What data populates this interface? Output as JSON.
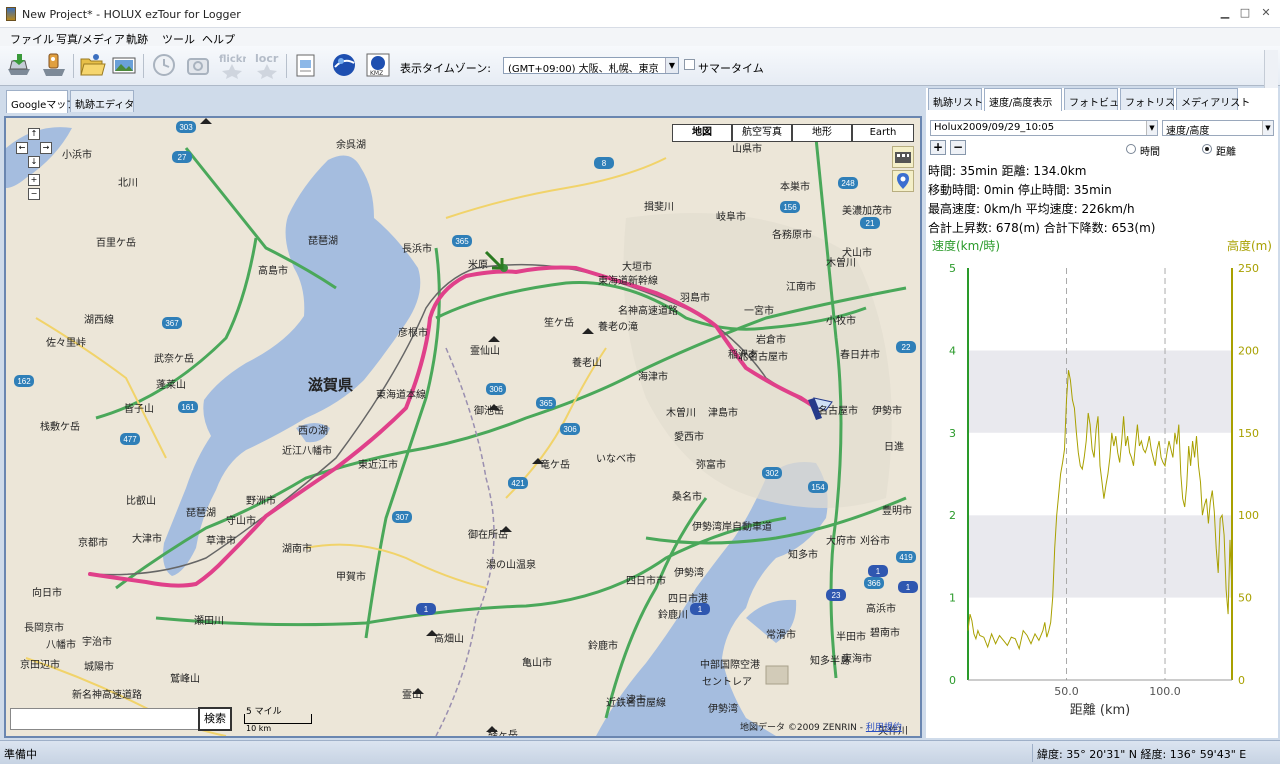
{
  "window": {
    "title": "New Project* - HOLUX ezTour for Logger"
  },
  "menu": [
    "ファイル",
    "写真/メディア",
    "軌跡",
    "ツール",
    "ヘルプ"
  ],
  "toolbar": {
    "timezone_label": "表示タイムゾーン:",
    "timezone_value": "(GMT+09:00) 大阪、札幌、東京",
    "dst_label": "サマータイム",
    "dst_checked": false,
    "icons": [
      "import-gps-icon",
      "gps-device-icon",
      "open-folder-icon",
      "photo-icon",
      "clock-icon",
      "camera-icon",
      "flickr-icon",
      "locr-icon",
      "export-file-icon",
      "google-earth-icon",
      "kmz-icon"
    ],
    "icon_texts": {
      "flickr": "flickr",
      "locr": "locr",
      "kmz": "KMZ"
    }
  },
  "left_tabs": [
    "Googleマップ",
    "軌跡エディタ"
  ],
  "map": {
    "types": [
      "地図",
      "航空写真",
      "地形",
      "Earth"
    ],
    "active_type": "地図",
    "nav": {
      "up": "↑",
      "left": "←",
      "right": "→",
      "down": "↓",
      "zoom_in": "+",
      "zoom_out": "−"
    },
    "search_button": "検索",
    "search_value": "",
    "scale_mi": "5 マイル",
    "scale_km": "10 km",
    "copyright": "地図データ ©2009 ZENRIN -",
    "terms_link": "利用規約",
    "labels": [
      {
        "t": "小浜市"
      },
      {
        "t": "余呉湖"
      },
      {
        "t": "北川"
      },
      {
        "t": "琵琶湖"
      },
      {
        "t": "長浜市"
      },
      {
        "t": "米原"
      },
      {
        "t": "東海道新幹線"
      },
      {
        "t": "名神高速道路"
      },
      {
        "t": "大垣市"
      },
      {
        "t": "羽島市"
      },
      {
        "t": "一宮市"
      },
      {
        "t": "岩倉市"
      },
      {
        "t": "北名古屋市"
      },
      {
        "t": "稲沢市"
      },
      {
        "t": "春日井市"
      },
      {
        "t": "名古屋市"
      },
      {
        "t": "滋賀県"
      },
      {
        "t": "東海道本線"
      },
      {
        "t": "彦根市"
      },
      {
        "t": "霊仙山"
      },
      {
        "t": "笙ケ岳"
      },
      {
        "t": "養老の滝"
      },
      {
        "t": "養老山"
      },
      {
        "t": "海津市"
      },
      {
        "t": "木曽川"
      },
      {
        "t": "津島市"
      },
      {
        "t": "愛西市"
      },
      {
        "t": "弥富市"
      },
      {
        "t": "桑名市"
      },
      {
        "t": "近江八幡市"
      },
      {
        "t": "西の湖"
      },
      {
        "t": "東近江市"
      },
      {
        "t": "御池岳"
      },
      {
        "t": "竜ケ岳"
      },
      {
        "t": "いなべ市"
      },
      {
        "t": "野洲市"
      },
      {
        "t": "守山市"
      },
      {
        "t": "草津市"
      },
      {
        "t": "湖南市"
      },
      {
        "t": "甲賀市"
      },
      {
        "t": "御在所岳"
      },
      {
        "t": "湯の山温泉"
      },
      {
        "t": "伊勢湾岸自動車道"
      },
      {
        "t": "四日市市"
      },
      {
        "t": "四日市港"
      },
      {
        "t": "鈴鹿川"
      },
      {
        "t": "伊勢湾"
      },
      {
        "t": "知多市"
      },
      {
        "t": "京都市"
      },
      {
        "t": "大津市"
      },
      {
        "t": "瀬田川"
      },
      {
        "t": "向日市"
      },
      {
        "t": "長岡京市"
      },
      {
        "t": "宇治市"
      },
      {
        "t": "城陽市"
      },
      {
        "t": "八幡市"
      },
      {
        "t": "京田辺市"
      },
      {
        "t": "新名神高速道路"
      },
      {
        "t": "高畑山"
      },
      {
        "t": "鈴鹿市"
      },
      {
        "t": "亀山市"
      },
      {
        "t": "津市"
      },
      {
        "t": "中部国際空港"
      },
      {
        "t": "セントレア"
      },
      {
        "t": "常滑市"
      },
      {
        "t": "知多半島"
      },
      {
        "t": "半田市"
      },
      {
        "t": "伊勢湾"
      },
      {
        "t": "鷲峰山"
      },
      {
        "t": "霊山"
      },
      {
        "t": "経ヶ岳"
      },
      {
        "t": "百里ケ岳"
      },
      {
        "t": "高島市"
      },
      {
        "t": "佐々里峠"
      },
      {
        "t": "武奈ケ岳"
      },
      {
        "t": "蓬莱山"
      },
      {
        "t": "皆子山"
      },
      {
        "t": "栈敷ケ岳"
      },
      {
        "t": "比叡山"
      },
      {
        "t": "山県市"
      },
      {
        "t": "本巣市"
      },
      {
        "t": "揖斐川"
      },
      {
        "t": "岐阜市"
      },
      {
        "t": "各務原市"
      },
      {
        "t": "美濃加茂市"
      },
      {
        "t": "犬山市"
      },
      {
        "t": "木曽川"
      },
      {
        "t": "江南市"
      },
      {
        "t": "小牧市"
      },
      {
        "t": "豊明市"
      },
      {
        "t": "大府市"
      },
      {
        "t": "刈谷市"
      },
      {
        "t": "高浜市"
      },
      {
        "t": "碧南市"
      },
      {
        "t": "東海市"
      },
      {
        "t": "矢作川"
      },
      {
        "t": "日進"
      },
      {
        "t": "湖西線"
      },
      {
        "t": "近鉄名古屋線"
      },
      {
        "t": "伊勢市"
      },
      {
        "t": "琵琶湖"
      }
    ],
    "road_shields": [
      "27",
      "303",
      "8",
      "365",
      "156",
      "248",
      "21",
      "367",
      "161",
      "162",
      "477",
      "306",
      "365",
      "306",
      "421",
      "307",
      "1",
      "1",
      "302",
      "154",
      "23",
      "1",
      "1",
      "366",
      "419",
      "22"
    ]
  },
  "right_tabs": [
    "軌跡リスト",
    "速度/高度表示",
    "フォトビュー",
    "フォトリスト",
    "メディアリスト"
  ],
  "right_active_tab": "速度/高度表示",
  "profile": {
    "track": "Holux2009/09/29_10:05",
    "mode": "速度/高度",
    "zoom_in": "+",
    "zoom_out": "−",
    "axis_options": [
      "時間",
      "距離"
    ],
    "axis_selected": "距離",
    "stats": [
      "時間: 35min 距離: 134.0km",
      "移動時間: 0min 停止時間: 35min",
      "最高速度: 0km/h 平均速度: 226km/h",
      "合計上昇数: 678(m) 合計下降数: 653(m)"
    ]
  },
  "chart_data": {
    "type": "line",
    "xlabel": "距離 (km)",
    "ylabel_left": "速度(km/時)",
    "ylabel_right": "高度(m)",
    "xlim": [
      0,
      134
    ],
    "y_left_lim": [
      0,
      5
    ],
    "y_right_lim": [
      0,
      250
    ],
    "x_ticks": [
      50.0,
      100.0
    ],
    "x_tick_labels": [
      "50.0",
      "100.0"
    ],
    "y_left_ticks": [
      0,
      1,
      2,
      3,
      4,
      5
    ],
    "y_right_ticks": [
      0,
      50,
      100,
      150,
      200,
      250
    ],
    "grid": true,
    "series": [
      {
        "axis": "right",
        "color": "#a8a000",
        "x": [
          0,
          1,
          2,
          3,
          4,
          5,
          6,
          8,
          10,
          12,
          14,
          16,
          18,
          20,
          22,
          24,
          26,
          28,
          30,
          32,
          34,
          36,
          38,
          39,
          40,
          41,
          42,
          43,
          44,
          45,
          46,
          47,
          48,
          49,
          50,
          51,
          52,
          53,
          54,
          55,
          56,
          57,
          58,
          59,
          60,
          61,
          62,
          63,
          64,
          65,
          66,
          67,
          68,
          69,
          70,
          71,
          72,
          73,
          74,
          75,
          76,
          77,
          78,
          79,
          80,
          81,
          82,
          83,
          84,
          85,
          86,
          87,
          88,
          89,
          90,
          91,
          92,
          93,
          94,
          95,
          96,
          97,
          98,
          99,
          100,
          101,
          102,
          103,
          104,
          105,
          106,
          107,
          108,
          109,
          110,
          111,
          112,
          113,
          114,
          115,
          116,
          117,
          118,
          119,
          120,
          121,
          122,
          123,
          124,
          125,
          126,
          127,
          128,
          129,
          130,
          131,
          132,
          133,
          134
        ],
        "y": [
          30,
          40,
          36,
          28,
          25,
          30,
          27,
          26,
          20,
          28,
          22,
          27,
          24,
          21,
          26,
          25,
          19,
          30,
          27,
          22,
          28,
          24,
          30,
          35,
          26,
          30,
          35,
          50,
          80,
          100,
          112,
          125,
          132,
          140,
          170,
          188,
          182,
          170,
          165,
          150,
          138,
          130,
          128,
          135,
          145,
          162,
          155,
          140,
          135,
          152,
          160,
          130,
          120,
          110,
          118,
          125,
          135,
          150,
          142,
          148,
          138,
          132,
          145,
          160,
          142,
          148,
          138,
          135,
          130,
          143,
          155,
          142,
          145,
          140,
          138,
          142,
          148,
          140,
          135,
          130,
          140,
          145,
          135,
          132,
          130,
          138,
          145,
          140,
          135,
          150,
          143,
          155,
          125,
          110,
          105,
          118,
          142,
          130,
          145,
          135,
          148,
          130,
          120,
          100,
          106,
          110,
          95,
          108,
          115,
          102,
          80,
          65,
          98,
          100,
          88,
          55,
          40,
          85,
          52
        ]
      }
    ]
  },
  "status": {
    "text": "準備中",
    "coords": "緯度: 35° 20'31\" N  経度: 136° 59'43\" E"
  }
}
